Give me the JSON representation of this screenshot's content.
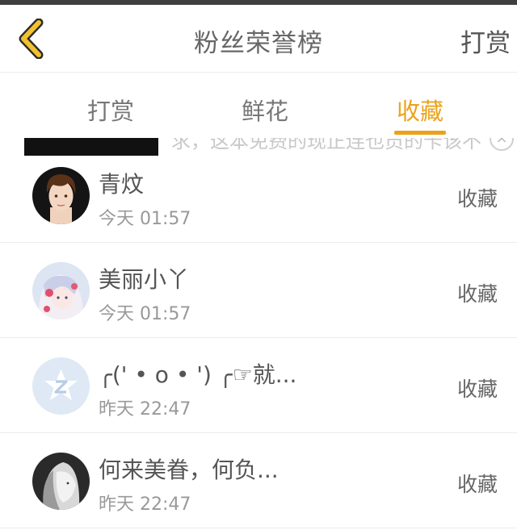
{
  "header": {
    "title": "粉丝荣誉榜",
    "action_label": "打赏",
    "back_icon": "chevron-left-icon",
    "accent_color": "#eba31b"
  },
  "tabs": [
    {
      "label": "打赏",
      "active": false
    },
    {
      "label": "鲜花",
      "active": false
    },
    {
      "label": "收藏",
      "active": true
    }
  ],
  "banner": {
    "text": "求，这本免费的现正连也员的卡该不"
  },
  "list": [
    {
      "name": "青炆",
      "time": "今天 01:57",
      "action": "收藏",
      "avatar": "boy-avatar"
    },
    {
      "name": "美丽小丫",
      "time": "今天 01:57",
      "action": "收藏",
      "avatar": "anime-girl-avatar"
    },
    {
      "name": "╭(' • o • ') ╭☞就...",
      "time": "昨天 22:47",
      "action": "收藏",
      "avatar": "default-z-avatar"
    },
    {
      "name": "何来美眷，何负...",
      "time": "昨天 22:47",
      "action": "收藏",
      "avatar": "bw-portrait-avatar"
    }
  ]
}
